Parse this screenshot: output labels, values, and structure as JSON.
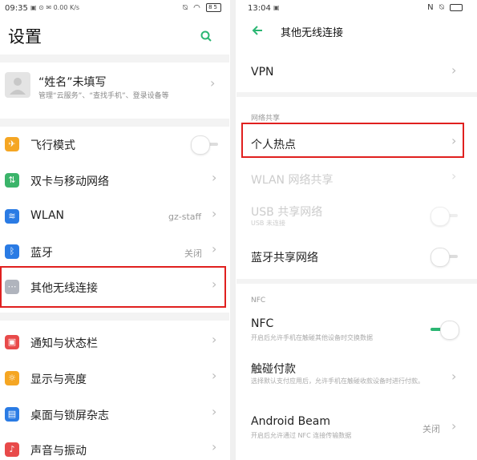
{
  "left": {
    "status": {
      "time": "09:35",
      "battery": "85",
      "speed": "0.00 K/s"
    },
    "title": "设置",
    "profile": {
      "name": "“姓名”未填写",
      "sub": "管理“云服务”、“查找手机”、登录设备等"
    },
    "items": [
      {
        "label": "飞行模式",
        "color": "#f5a623",
        "icon": "✈"
      },
      {
        "label": "双卡与移动网络",
        "color": "#3bb46a",
        "icon": "⇅"
      },
      {
        "label": "WLAN",
        "value": "gz-staff",
        "color": "#2a7be4",
        "icon": "≋"
      },
      {
        "label": "蓝牙",
        "value": "关闭",
        "color": "#2a7be4",
        "icon": "ᛒ"
      },
      {
        "label": "其他无线连接",
        "color": "#b0b4bd",
        "icon": "⋯"
      },
      {
        "label": "通知与状态栏",
        "color": "#e84a4a",
        "icon": "▣"
      },
      {
        "label": "显示与亮度",
        "color": "#f5a623",
        "icon": "☼"
      },
      {
        "label": "桌面与锁屏杂志",
        "color": "#2a7be4",
        "icon": "▤"
      },
      {
        "label": "声音与振动",
        "color": "#e84a4a",
        "icon": "♪"
      }
    ]
  },
  "right": {
    "status": {
      "time": "13:04"
    },
    "title": "其他无线连接",
    "vpn": "VPN",
    "section_share": "网络共享",
    "hotspot": "个人热点",
    "wlan_share": "WLAN 网络共享",
    "usb_share": "USB 共享网络",
    "usb_sub": "USB 未连接",
    "bt_share": "蓝牙共享网络",
    "section_nfc": "NFC",
    "nfc": "NFC",
    "nfc_sub": "开启后允许手机在触碰其他设备时交换数据",
    "pay": "触碰付款",
    "pay_sub": "选择默认支付应用后，允许手机在触碰收款设备时进行付款。",
    "beam": "Android Beam",
    "beam_sub": "开启后允许通过 NFC 连接传输数据",
    "beam_value": "关闭",
    "accent": "#2bb673"
  }
}
